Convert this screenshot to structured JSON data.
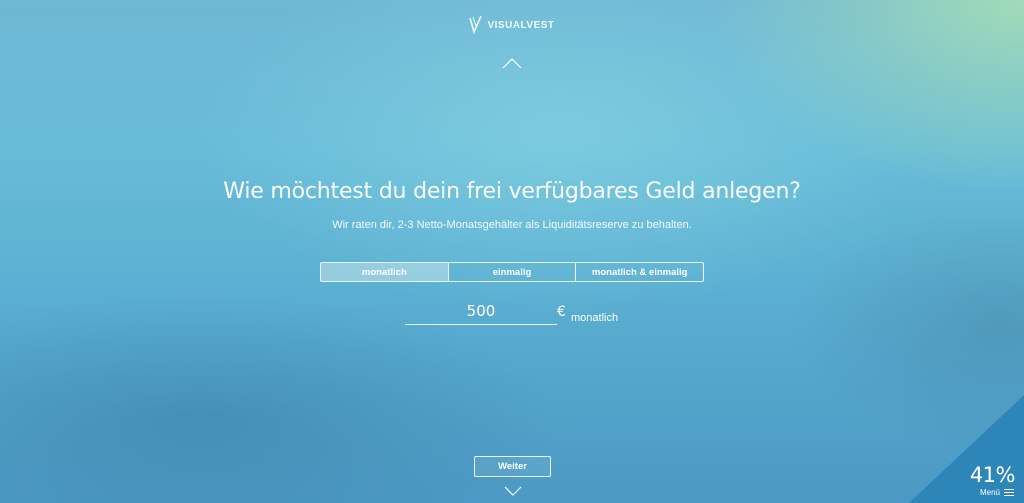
{
  "header": {
    "brand": "VISUALVEST",
    "logo_icon": "visualvest-v-icon",
    "prev_icon": "chevron-up-icon"
  },
  "question": {
    "title": "Wie möchtest du dein frei verfügbares Geld anlegen?",
    "hint": "Wir raten dir, 2-3 Netto-Monatsgehälter als Liquiditätsreserve zu behalten."
  },
  "payment_options": {
    "selected": "monatlich",
    "items": [
      {
        "label": "monatlich",
        "active": true
      },
      {
        "label": "einmalig",
        "active": false
      },
      {
        "label": "monatlich & einmalig",
        "active": false
      }
    ]
  },
  "amount": {
    "value": "500",
    "currency": "€",
    "period": "monatlich"
  },
  "footer": {
    "next_label": "Weiter",
    "next_icon": "chevron-down-icon"
  },
  "progress": {
    "value": "41%",
    "percent": 41,
    "menu_label": "Menü",
    "menu_icon": "hamburger-menu-icon",
    "color": "#2e86b8"
  }
}
